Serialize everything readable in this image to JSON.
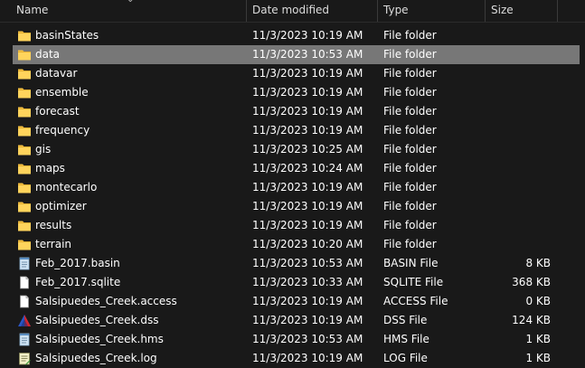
{
  "columns": {
    "name": "Name",
    "date": "Date modified",
    "type": "Type",
    "size": "Size"
  },
  "colors": {
    "background": "#191919",
    "selected_row": "#777777",
    "folder": "#f6c244"
  },
  "files": [
    {
      "name": "basinStates",
      "date": "11/3/2023 10:19 AM",
      "type": "File folder",
      "size": "",
      "icon": "folder-icon"
    },
    {
      "name": "data",
      "date": "11/3/2023 10:53 AM",
      "type": "File folder",
      "size": "",
      "icon": "folder-icon",
      "selected": true
    },
    {
      "name": "datavar",
      "date": "11/3/2023 10:19 AM",
      "type": "File folder",
      "size": "",
      "icon": "folder-icon"
    },
    {
      "name": "ensemble",
      "date": "11/3/2023 10:19 AM",
      "type": "File folder",
      "size": "",
      "icon": "folder-icon"
    },
    {
      "name": "forecast",
      "date": "11/3/2023 10:19 AM",
      "type": "File folder",
      "size": "",
      "icon": "folder-icon"
    },
    {
      "name": "frequency",
      "date": "11/3/2023 10:19 AM",
      "type": "File folder",
      "size": "",
      "icon": "folder-icon"
    },
    {
      "name": "gis",
      "date": "11/3/2023 10:25 AM",
      "type": "File folder",
      "size": "",
      "icon": "folder-icon"
    },
    {
      "name": "maps",
      "date": "11/3/2023 10:24 AM",
      "type": "File folder",
      "size": "",
      "icon": "folder-icon"
    },
    {
      "name": "montecarlo",
      "date": "11/3/2023 10:19 AM",
      "type": "File folder",
      "size": "",
      "icon": "folder-icon"
    },
    {
      "name": "optimizer",
      "date": "11/3/2023 10:19 AM",
      "type": "File folder",
      "size": "",
      "icon": "folder-icon"
    },
    {
      "name": "results",
      "date": "11/3/2023 10:19 AM",
      "type": "File folder",
      "size": "",
      "icon": "folder-icon"
    },
    {
      "name": "terrain",
      "date": "11/3/2023 10:20 AM",
      "type": "File folder",
      "size": "",
      "icon": "folder-icon"
    },
    {
      "name": "Feb_2017.basin",
      "date": "11/3/2023 10:53 AM",
      "type": "BASIN File",
      "size": "8 KB",
      "icon": "notepad-file-icon"
    },
    {
      "name": "Feb_2017.sqlite",
      "date": "11/3/2023 10:33 AM",
      "type": "SQLITE File",
      "size": "368 KB",
      "icon": "blank-file-icon"
    },
    {
      "name": "Salsipuedes_Creek.access",
      "date": "11/3/2023 10:19 AM",
      "type": "ACCESS File",
      "size": "0 KB",
      "icon": "blank-file-icon"
    },
    {
      "name": "Salsipuedes_Creek.dss",
      "date": "11/3/2023 10:19 AM",
      "type": "DSS File",
      "size": "124 KB",
      "icon": "dss-file-icon"
    },
    {
      "name": "Salsipuedes_Creek.hms",
      "date": "11/3/2023 10:53 AM",
      "type": "HMS File",
      "size": "1 KB",
      "icon": "notepad-file-icon"
    },
    {
      "name": "Salsipuedes_Creek.log",
      "date": "11/3/2023 10:19 AM",
      "type": "LOG File",
      "size": "1 KB",
      "icon": "log-file-icon"
    }
  ]
}
